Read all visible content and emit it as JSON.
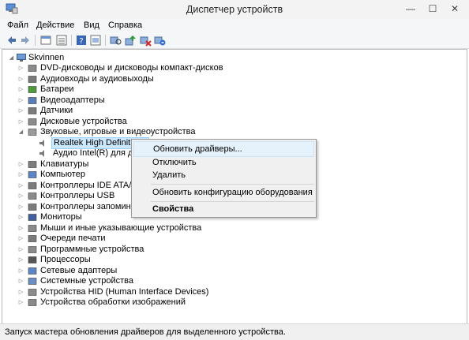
{
  "window": {
    "title": "Диспетчер устройств",
    "controls": {
      "minimize": "—",
      "maximize": "☐",
      "close": "✕"
    }
  },
  "menu": [
    "Файл",
    "Действие",
    "Вид",
    "Справка"
  ],
  "toolbar": {
    "buttons": [
      "back-arrow-icon",
      "forward-arrow-icon",
      "properties-icon",
      "list-icon",
      "help-icon",
      "show-hidden-icon",
      "scan-hardware-icon",
      "update-driver-icon",
      "disable-device-icon",
      "uninstall-device-icon"
    ]
  },
  "tree": {
    "root": "Skvinnen",
    "categories": [
      {
        "label": "DVD-дисководы и дисководы компакт-дисков",
        "icon": "dvd-icon"
      },
      {
        "label": "Аудиовходы и аудиовыходы",
        "icon": "audio-io-icon"
      },
      {
        "label": "Батареи",
        "icon": "battery-icon"
      },
      {
        "label": "Видеоадаптеры",
        "icon": "display-adapter-icon"
      },
      {
        "label": "Датчики",
        "icon": "sensor-icon"
      },
      {
        "label": "Дисковые устройства",
        "icon": "disk-icon"
      },
      {
        "label": "Звуковые, игровые и видеоустройства",
        "icon": "sound-icon",
        "expanded": true,
        "children": [
          {
            "label": "Realtek High Definition Audio",
            "selected": true
          },
          {
            "label": "Аудио Intel(R) для диспл"
          }
        ]
      },
      {
        "label": "Клавиатуры",
        "icon": "keyboard-icon"
      },
      {
        "label": "Компьютер",
        "icon": "computer-icon"
      },
      {
        "label": "Контроллеры IDE ATA/ATA",
        "icon": "ide-controller-icon"
      },
      {
        "label": "Контроллеры USB",
        "icon": "usb-icon"
      },
      {
        "label": "Контроллеры запоминающ",
        "icon": "storage-controller-icon"
      },
      {
        "label": "Мониторы",
        "icon": "monitor-icon"
      },
      {
        "label": "Мыши и иные указывающие устройства",
        "icon": "mouse-icon"
      },
      {
        "label": "Очереди печати",
        "icon": "printer-icon"
      },
      {
        "label": "Программные устройства",
        "icon": "software-device-icon"
      },
      {
        "label": "Процессоры",
        "icon": "processor-icon"
      },
      {
        "label": "Сетевые адаптеры",
        "icon": "network-adapter-icon"
      },
      {
        "label": "Системные устройства",
        "icon": "system-device-icon"
      },
      {
        "label": "Устройства HID (Human Interface Devices)",
        "icon": "hid-icon"
      },
      {
        "label": "Устройства обработки изображений",
        "icon": "imaging-device-icon"
      }
    ]
  },
  "context_menu": {
    "items": [
      {
        "label": "Обновить драйверы...",
        "highlighted": true
      },
      {
        "label": "Отключить"
      },
      {
        "label": "Удалить"
      },
      {
        "separator": true
      },
      {
        "label": "Обновить конфигурацию оборудования"
      },
      {
        "separator": true
      },
      {
        "label": "Свойства",
        "bold": true
      }
    ]
  },
  "status_bar": "Запуск мастера обновления драйверов для выделенного устройства.",
  "colors": {
    "selection": "#cce8ff",
    "menu_highlight": "#e5f1fb",
    "folder": "#e8c060"
  }
}
